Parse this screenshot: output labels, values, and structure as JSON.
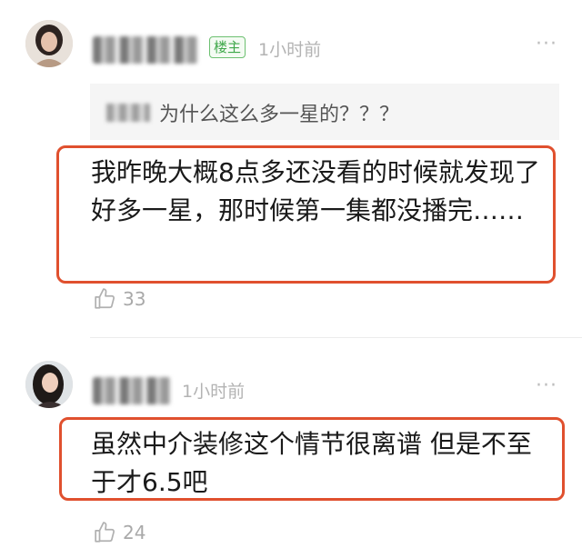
{
  "comments": [
    {
      "avatar": "avatar-woman-dark-hair",
      "op_badge": "楼主",
      "time": "1小时前",
      "quote_text": "为什么这么多一星的？？？",
      "text": "我昨晚大概8点多还没看的时候就发现了好多一星，那时候第一集都没播完……",
      "likes": "33"
    },
    {
      "avatar": "avatar-woman-long-hair",
      "time": "1小时前",
      "text": "虽然中介装修这个情节很离谱 但是不至于才6.5吧",
      "likes": "24"
    }
  ],
  "colors": {
    "highlight": "#e0502e",
    "badge": "#3fa84a",
    "muted": "#b3b3b3"
  },
  "icons": {
    "more": "more-icon",
    "like": "thumbs-up-icon"
  }
}
